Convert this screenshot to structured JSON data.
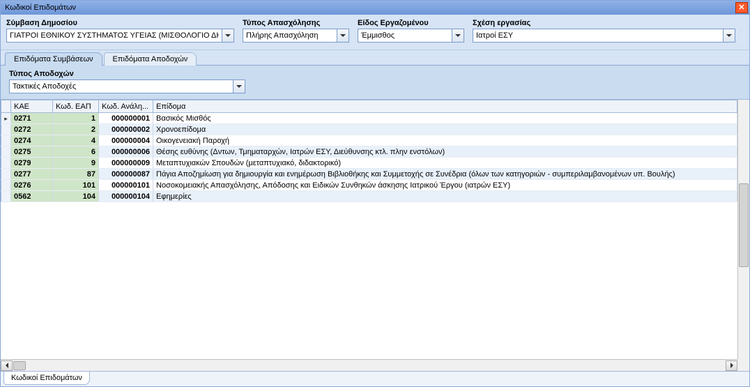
{
  "title": "Κωδικοί Επιδομάτων",
  "filters": {
    "contract": {
      "label": "Σύμβαση Δημοσίου",
      "value": "ΓΙΑΤΡΟΙ ΕΘΝΙΚΟΥ ΣΥΣΤΗΜΑΤΟΣ ΥΓΕΙΑΣ (ΜΙΣΘΟΛΟΓΙΟ ΔΗΜ("
    },
    "emptype": {
      "label": "Τύπος Απασχόλησης",
      "value": "Πλήρης Απασχόληση"
    },
    "empkind": {
      "label": "Είδος Εργαζομένου",
      "value": "Έμμισθος"
    },
    "relation": {
      "label": "Σχέση εργασίας",
      "value": "Ιατροί ΕΣΥ"
    }
  },
  "tabs": {
    "t1": "Επιδόματα Συμβάσεων",
    "t2": "Επιδόματα Αποδοχών"
  },
  "sub": {
    "label": "Τύπος Αποδοχών",
    "value": "Τακτικές Αποδοχές"
  },
  "cols": {
    "kae": "ΚΑΕ",
    "eap": "Κωδ. ΕΑΠ",
    "anal": "Κωδ. Ανάλη...",
    "epid": "Επίδομα"
  },
  "rows": [
    {
      "kae": "0271",
      "eap": "1",
      "anal": "000000001",
      "epid": "Βασικός Μισθός"
    },
    {
      "kae": "0272",
      "eap": "2",
      "anal": "000000002",
      "epid": "Χρονοεπίδομα"
    },
    {
      "kae": "0274",
      "eap": "4",
      "anal": "000000004",
      "epid": "Οικογενειακή Παροχή"
    },
    {
      "kae": "0275",
      "eap": "6",
      "anal": "000000006",
      "epid": "Θέσης ευθύνης (Δντων, Τμηματαρχών, Ιατρών ΕΣΥ, Διεύθυνσης κτλ. πλην ενστόλων)"
    },
    {
      "kae": "0279",
      "eap": "9",
      "anal": "000000009",
      "epid": "Μεταπτυχιακών Σπουδών (μεταπτυχιακό, διδακτορικό)"
    },
    {
      "kae": "0277",
      "eap": "87",
      "anal": "000000087",
      "epid": "Πάγια Αποζημίωση για δημιουργία και ενημέρωση Βιβλιοθήκης και Συμμετοχής σε Συνέδρια (όλων των κατηγοριών - συμπεριλαμβανομένων υπ. Βουλής)"
    },
    {
      "kae": "0276",
      "eap": "101",
      "anal": "000000101",
      "epid": "Νοσοκομειακής Απασχόλησης, Απόδοσης και  Ειδικών Συνθηκών άσκησης  Ιατρικού Έργου (ιατρών ΕΣΥ)"
    },
    {
      "kae": "0562",
      "eap": "104",
      "anal": "000000104",
      "epid": "Εφημερίες"
    }
  ],
  "bottom_tab": "Κωδικοί Επιδομάτων"
}
